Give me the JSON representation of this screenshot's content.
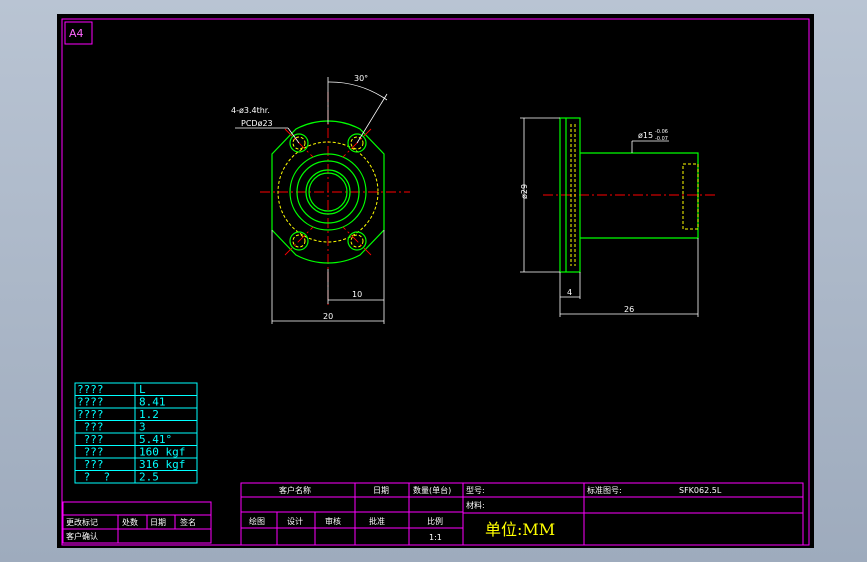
{
  "sheet": {
    "size_label": "A4"
  },
  "dimensions": {
    "angle": "30°",
    "holes_line1": "4-ø3.4thr.",
    "holes_line2": "PCDø23",
    "width_half": "10",
    "width_total": "20",
    "diameter_flange": "ø29",
    "diameter_shaft": "ø15",
    "tol_upper": "-0.06",
    "tol_lower": "-0.07",
    "flange_thickness": "4",
    "total_length": "26"
  },
  "spec_table": {
    "rows": [
      {
        "label": "????",
        "value": "L"
      },
      {
        "label": "????",
        "value": "8.41"
      },
      {
        "label": "????",
        "value": "1.2"
      },
      {
        "label": " ???",
        "value": "3"
      },
      {
        "label": " ???",
        "value": "5.41°"
      },
      {
        "label": " ???",
        "value": "160 kgf"
      },
      {
        "label": " ???",
        "value": "316 kgf"
      },
      {
        "label": " ?  ?",
        "value": "2.5"
      }
    ]
  },
  "revision_block": {
    "row1": [
      "更改标记",
      "处数",
      "日期",
      "签名"
    ],
    "row2": [
      "客户确认"
    ]
  },
  "title_block": {
    "customer_name": "客户名称",
    "date": "日期",
    "qty": "数量(单台)",
    "model": "型号:",
    "drawing_no_label": "标准图号:",
    "drawing_no_value": "SFK062.5L",
    "material": "材料:",
    "draw": "绘图",
    "design": "设计",
    "audit": "审核",
    "approve": "批准",
    "scale_label": "比例",
    "scale_value": "1:1",
    "unit": "单位:MM"
  }
}
